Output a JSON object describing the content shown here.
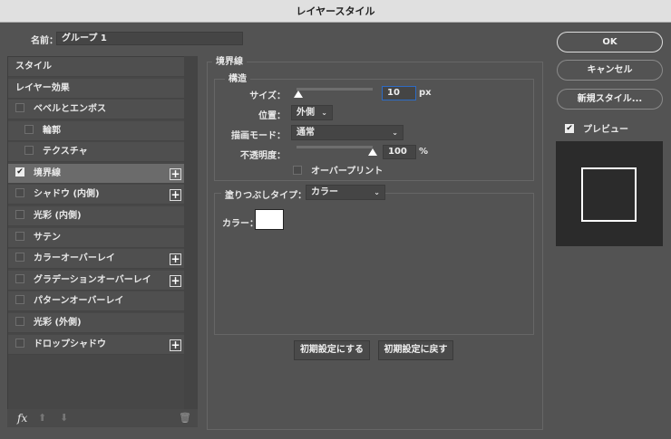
{
  "window": {
    "title": "レイヤースタイル"
  },
  "name": {
    "label": "名前：",
    "value": "グループ 1"
  },
  "styles": {
    "header": "スタイル",
    "effects_header": "レイヤー効果",
    "items": [
      {
        "label": "ベベルとエンボス",
        "checked": false,
        "plus": false,
        "indent": false
      },
      {
        "label": "輪郭",
        "checked": false,
        "plus": false,
        "indent": true
      },
      {
        "label": "テクスチャ",
        "checked": false,
        "plus": false,
        "indent": true
      },
      {
        "label": "境界線",
        "checked": true,
        "plus": true,
        "indent": false,
        "selected": true
      },
      {
        "label": "シャドウ (内側)",
        "checked": false,
        "plus": true,
        "indent": false
      },
      {
        "label": "光彩 (内側)",
        "checked": false,
        "plus": false,
        "indent": false
      },
      {
        "label": "サテン",
        "checked": false,
        "plus": false,
        "indent": false
      },
      {
        "label": "カラーオーバーレイ",
        "checked": false,
        "plus": true,
        "indent": false
      },
      {
        "label": "グラデーションオーバーレイ",
        "checked": false,
        "plus": true,
        "indent": false
      },
      {
        "label": "パターンオーバーレイ",
        "checked": false,
        "plus": false,
        "indent": false
      },
      {
        "label": "光彩 (外側)",
        "checked": false,
        "plus": false,
        "indent": false
      },
      {
        "label": "ドロップシャドウ",
        "checked": false,
        "plus": true,
        "indent": false
      }
    ],
    "fx_label": "fx"
  },
  "stroke": {
    "title": "境界線",
    "structure": "構造",
    "size_label": "サイズ：",
    "size_value": "10",
    "size_unit": "px",
    "size_fraction": 0.02,
    "position_label": "位置：",
    "position_value": "外側",
    "blend_label": "描画モード：",
    "blend_value": "通常",
    "opacity_label": "不透明度：",
    "opacity_value": "100",
    "opacity_unit": "%",
    "opacity_fraction": 1.0,
    "overprint_label": "オーバープリント",
    "overprint_checked": false,
    "fill_label": "塗りつぶしタイプ：",
    "fill_value": "カラー",
    "color_label": "カラー：",
    "color": "#ffffff",
    "make_default": "初期設定にする",
    "reset_default": "初期設定に戻す"
  },
  "buttons": {
    "ok": "OK",
    "cancel": "キャンセル",
    "new_style": "新規スタイル..."
  },
  "preview": {
    "label": "プレビュー",
    "checked": true
  }
}
